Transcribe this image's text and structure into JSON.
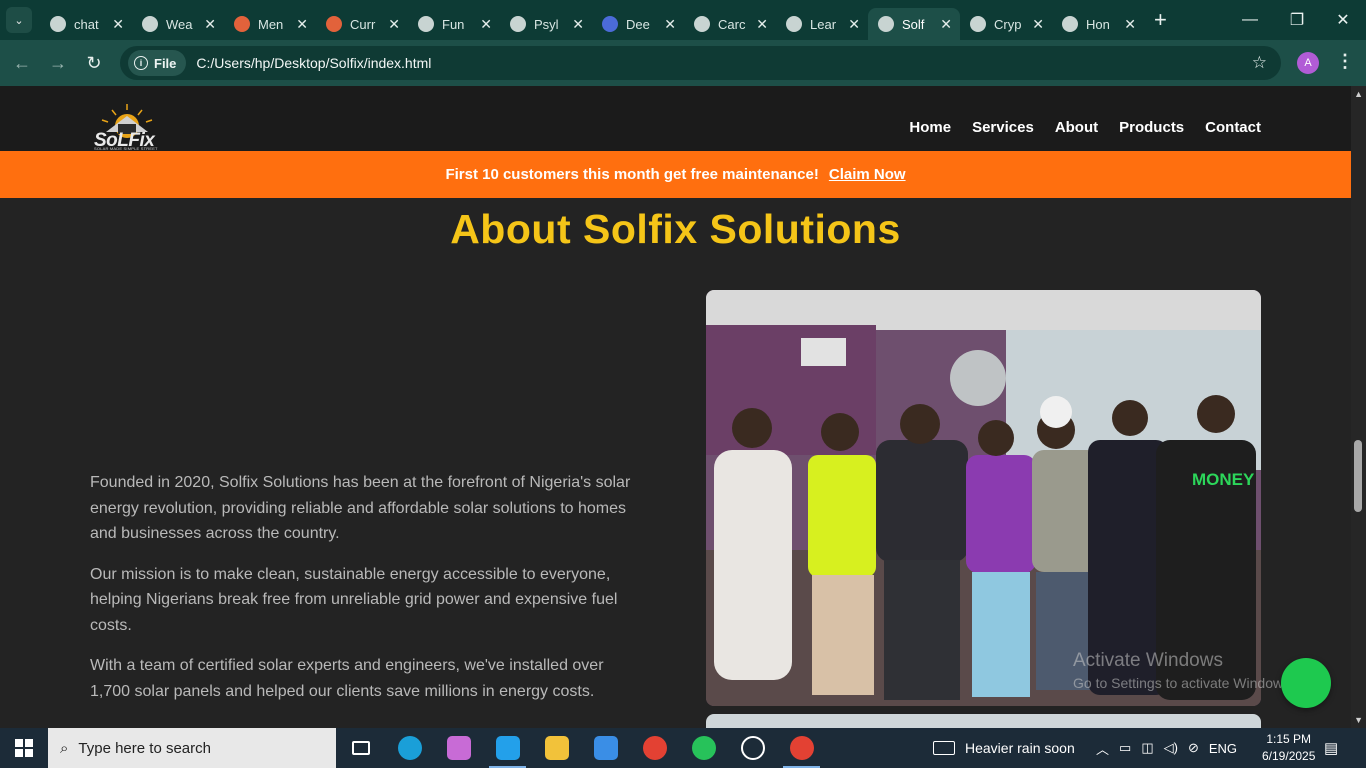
{
  "browser": {
    "tabs": [
      {
        "label": "chat",
        "favicon": "chatgpt-icon",
        "active": false
      },
      {
        "label": "Wea",
        "favicon": "globe-icon",
        "active": false
      },
      {
        "label": "Men",
        "favicon": "fox-icon",
        "active": false
      },
      {
        "label": "Curr",
        "favicon": "fox-icon",
        "active": false
      },
      {
        "label": "Fun",
        "favicon": "globe-icon",
        "active": false
      },
      {
        "label": "Psyl",
        "favicon": "globe-icon",
        "active": false
      },
      {
        "label": "Dee",
        "favicon": "deepseek-icon",
        "active": false
      },
      {
        "label": "Carc",
        "favicon": "globe-icon",
        "active": false
      },
      {
        "label": "Lear",
        "favicon": "globe-icon",
        "active": false
      },
      {
        "label": "Solf",
        "favicon": "globe-icon",
        "active": true
      },
      {
        "label": "Cryp",
        "favicon": "globe-icon",
        "active": false
      },
      {
        "label": "Hon",
        "favicon": "globe-icon",
        "active": false
      }
    ],
    "chip_label": "File",
    "url": "C:/Users/hp/Desktop/Solfix/index.html",
    "profile_initial": "A"
  },
  "site": {
    "logo_text": "SoLFix",
    "logo_tagline": "SOLAR MADE SIMPLE STREET",
    "nav": [
      "Home",
      "Services",
      "About",
      "Products",
      "Contact"
    ],
    "promo_text": "First 10 customers this month get free maintenance!",
    "promo_cta": "Claim Now",
    "about_title": "About Solfix Solutions",
    "paragraphs": [
      "Founded in 2020, Solfix Solutions has been at the forefront of Nigeria's solar energy revolution, providing reliable and affordable solar solutions to homes and businesses across the country.",
      "Our mission is to make clean, sustainable energy accessible to everyone, helping Nigerians break free from unreliable grid power and expensive fuel costs.",
      "With a team of certified solar experts and engineers, we've installed over 1,700 solar panels and helped our clients save millions in energy costs."
    ],
    "photo_shirt_text": "MONEY",
    "watermark_line1": "Activate Windows",
    "watermark_line2": "Go to Settings to activate Windows."
  },
  "taskbar": {
    "search_placeholder": "Type here to search",
    "weather": "Heavier rain soon",
    "language": "ENG",
    "time": "1:15 PM",
    "date": "6/19/2025"
  },
  "colors": {
    "accent": "#f5c518",
    "promo": "#ff6f0f",
    "chrome": "#0d3b35",
    "chat_fab": "#1ec94f"
  }
}
